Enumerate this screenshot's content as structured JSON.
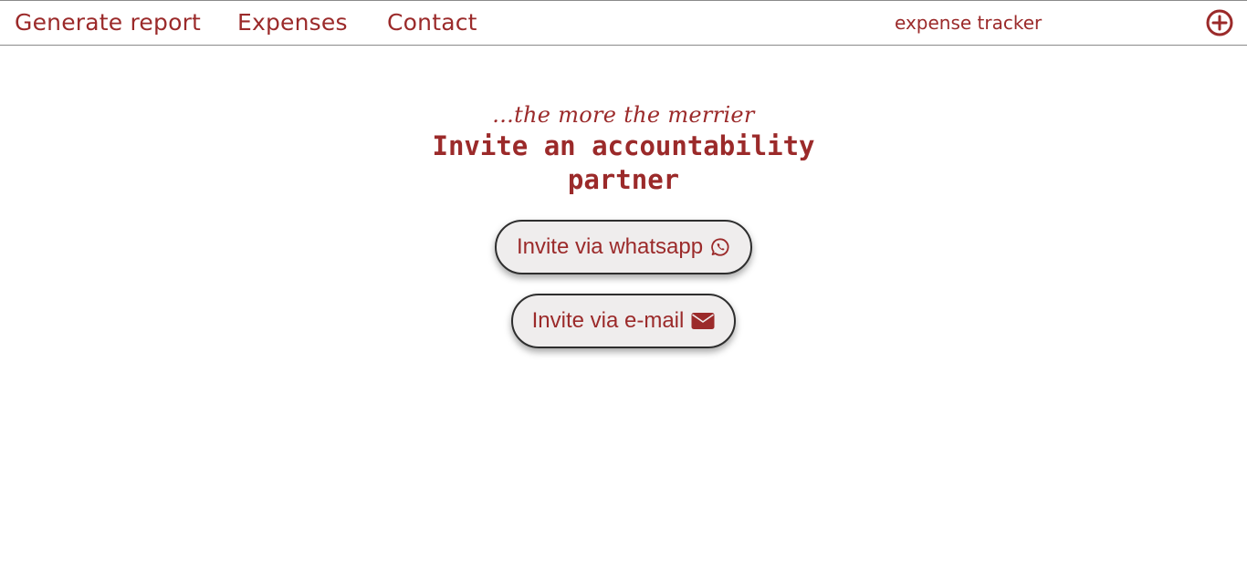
{
  "nav": {
    "links": [
      {
        "label": "Generate report"
      },
      {
        "label": "Expenses"
      },
      {
        "label": "Contact"
      }
    ],
    "brand": "expense tracker",
    "add_icon": "plus-circle-icon"
  },
  "hero": {
    "tagline": "...the more the merrier",
    "heading": "Invite an accountability partner"
  },
  "buttons": {
    "whatsapp": {
      "label": "Invite via whatsapp",
      "icon": "whatsapp-icon"
    },
    "email": {
      "label": "Invite via e-mail",
      "icon": "envelope-icon"
    }
  },
  "colors": {
    "accent": "#9b2a2a",
    "button_bg": "#efeded",
    "button_border": "#2e2e2e",
    "nav_border": "#8a8a8a"
  }
}
